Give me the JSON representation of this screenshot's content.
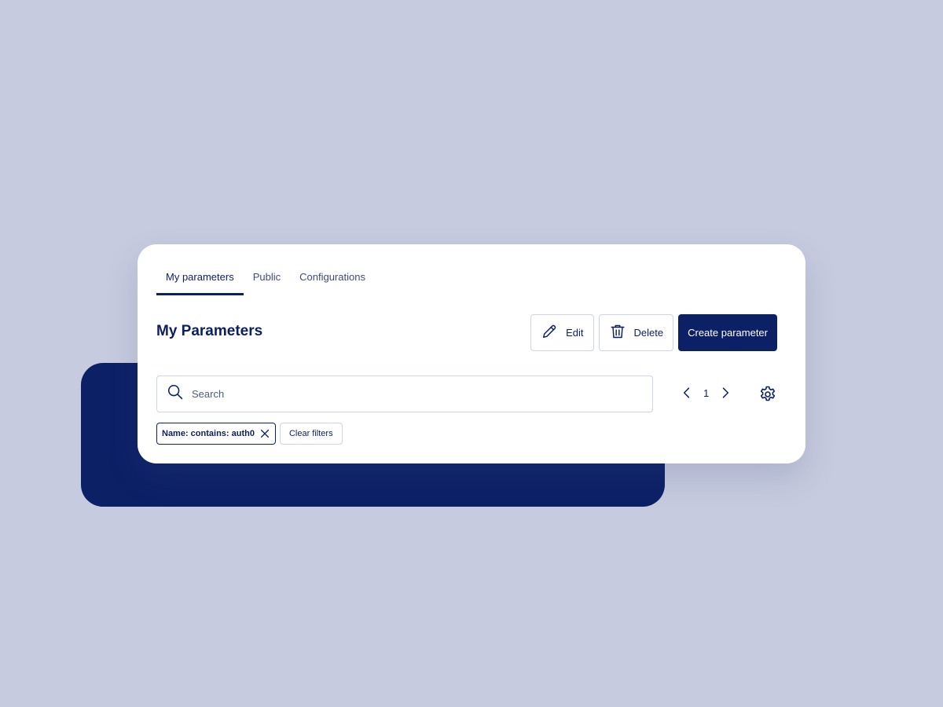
{
  "tabs": [
    {
      "label": "My parameters",
      "active": true
    },
    {
      "label": "Public",
      "active": false
    },
    {
      "label": "Configurations",
      "active": false
    }
  ],
  "header": {
    "title": "My Parameters"
  },
  "toolbar": {
    "edit_label": "Edit",
    "edit_icon": "pencil-icon",
    "delete_label": "Delete",
    "delete_icon": "trash-icon",
    "create_label": "Create parameter"
  },
  "search": {
    "placeholder": "Search",
    "value": "",
    "icon": "search-icon"
  },
  "pagination": {
    "current_page": "1"
  },
  "filters": {
    "active": [
      {
        "label": "Name: contains: auth0"
      }
    ],
    "clear_label": "Clear filters"
  },
  "colors": {
    "background": "#c6cbdf",
    "accent": "#0c2066",
    "card": "#ffffff",
    "border": "#cfd4e4"
  }
}
